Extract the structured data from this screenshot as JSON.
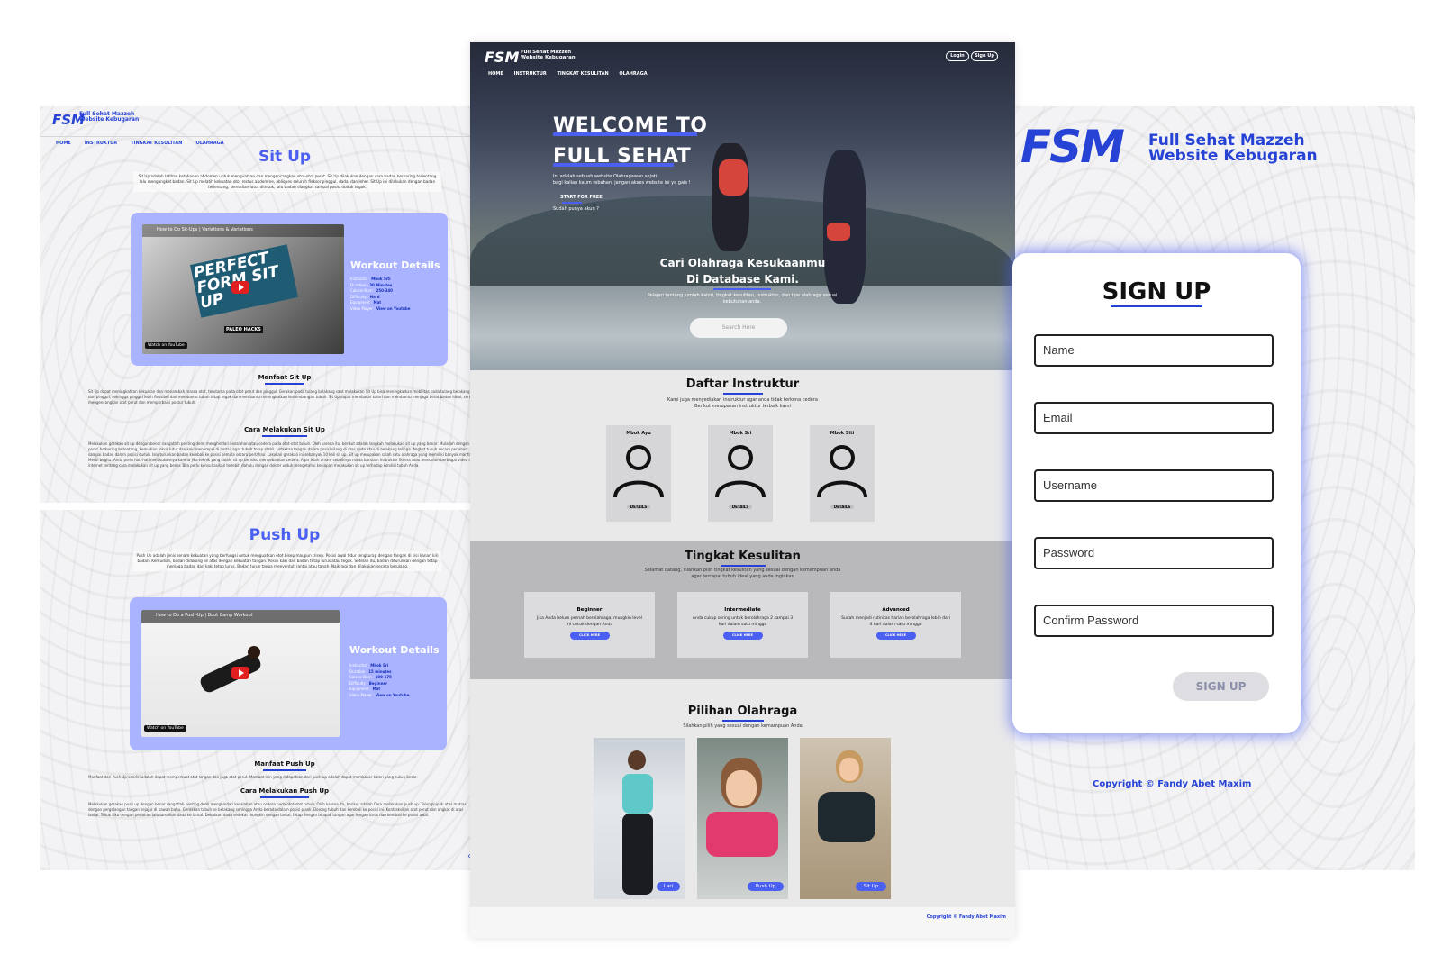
{
  "left_page": {
    "logo": "FSM",
    "brand_line1": "Full Sehat Mazzeh",
    "brand_line2": "Website Kebugaran",
    "nav": [
      "HOME",
      "INSTRUKTUR",
      "TINGKAT KESULITAN",
      "OLAHRAGA"
    ],
    "situp": {
      "title": "Sit Up",
      "intro": "Sit Up adalah latihan ketahanan abdomen untuk menguatkan dan mengencangkan otot-otot perut. Sit Up dilakukan dengan cara badan berbaring terlentang lalu mengangkat badan. Sit Up melatih kekuatan otot rectus abdomine, obliques seluruh fleksor pinggul, dada, dan leher. Sit Up ini dilakukan dengan badan terlentang, kemudian lutut ditekuk, lalu badan diangkat sampai posisi duduk tegak.",
      "video_title": "How to Do Sit-Ups | Variations & Variations",
      "video_caption": "PERFECT FORM SIT UP",
      "video_brand": "PALEO HACKS",
      "watch_on": "Watch on",
      "youtube": "YouTube",
      "details_title": "Workout Details",
      "details": [
        {
          "k": "Instructor",
          "v": "Mbok Siti"
        },
        {
          "k": "Duration",
          "v": "30 Minutes"
        },
        {
          "k": "Calorie Burn",
          "v": "250-340"
        },
        {
          "k": "Difficulty",
          "v": "Hard"
        },
        {
          "k": "Equipment",
          "v": "Mat"
        },
        {
          "k": "Video Player",
          "v": "View on Youtube"
        }
      ],
      "manfaat_title": "Manfaat Sit Up",
      "manfaat_text": "Sit Up dapat meningkatkan kekuatan dan menambah massa otot, terutama pada otot perut dan pinggul. Gerakan pada tulang belakang saat melakukan Sit Up bisa meningkatkan mobilitas pada tulang belakang dan pinggul, sehingga pinggul lebih fleksibel dan membantu tubuh tetap tegak dan membantu meningkatkan keseimbangan tubuh. Sit Up dapat membakar kalori dan membantu menjaga berat badan ideal, serta mengencangkan otot perut dan memperbaiki postur tubuh.",
      "cara_title": "Cara Melakukan Sit Up",
      "cara_text": "Melakukan gerakan sit up dengan benar sangatlah penting demi menghindari kesalahan atau cedera pada otot-otot tubuh. Oleh karena itu, berikut adalah langkah melakukan sit up yang benar: Mulailah dengan posisi berbaring terlentang, kemudian tekuk lutut dan kaki menempel di lantai, agar tubuh tetap stabil. Letakkan tangan dalam posisi silang di atas dada atau di belakang telinga. Angkat tubuh secara perlahan sampai badan dalam posisi duduk, lalu turunkan badan kembali ke posisi semula secara perlahan. Lakukan gerakan ini sebanyak 10 kali sit up. Sit up merupakan salah satu olahraga yang memiliki banyak manfaat. Meski begitu, Anda perlu hati-hati melakukannya karena jika teknik yang salah, sit up berisiko menyebabkan cedera. Agar lebih aman, sebaiknya minta bantuan instruktur fitness atau menonton berbagai video di internet tentang cara melakukan sit up yang benar. Bila perlu konsultasikan terlebih dahulu dengan dokter untuk mengetahui kesiapan melakukan sit up terhadap kondisi tubuh Anda.",
      "copyright_stub": "Co"
    },
    "pushup": {
      "title": "Push Up",
      "intro": "Push Up adalah jenis senam kekuatan yang berfungsi untuk menguatkan otot bisep maupun trisep. Posisi awal tidur tengkurap dengan tangan di sisi kanan kiri badan. Kemudian, badan didorong ke atas dengan kekuatan tangan. Posisi kaki dan badan tetap lurus atau tegak. Setelah itu, badan diturunkan dengan tetap menjaga badan dan kaki tetap lurus. Badan turun tanpa menyentuh lantai atau tanah. Naik lagi dan dilakukan secara berulang.",
      "video_title": "How to Do a Push-Up | Boot Camp Workout",
      "watch_on": "Watch on",
      "youtube": "YouTube",
      "details_title": "Workout Details",
      "details": [
        {
          "k": "Instructor",
          "v": "Mbok Sri"
        },
        {
          "k": "Duration",
          "v": "15 minutes"
        },
        {
          "k": "Calorie Burn",
          "v": "100-175"
        },
        {
          "k": "Difficulty",
          "v": "Beginner"
        },
        {
          "k": "Equipment",
          "v": "Mat"
        },
        {
          "k": "Video Player",
          "v": "View on Youtube"
        }
      ],
      "manfaat_title": "Manfaat Push Up",
      "manfaat_text": "Manfaat dari Push Up sendiri adalah dapat memperkuat otot lengan dan juga otot perut. Manfaat lain yang didapatkan dari push up adalah dapat membakar kalori yang cukup besar.",
      "cara_title": "Cara Melakukan Push Up",
      "cara_text": "Melakukan gerakan push up dengan benar sangatlah penting demi menghindari kesalahan atau cedera pada otot-otot tubuh. Oleh karena itu, berikut adalah Cara melakukan push up: Telungkup di atas matras dengan pergelangan tangan sejajar di bawah bahu. Gerakkan tubuh ke belakang sehingga Anda berada dalam posisi plank. Dorong tubuh dan kembali ke posisi ini. Kontraksikan otot perut dan angkat di atas lantai. Tekuk siku dengan perlahan lalu turunkan dada ke lantai. Dekatkan dada sedekat mungkin dengan lantai, tetap dengan telapak tangan agar lengan lurus dan kembali ke posisi awal.",
      "copyright_stub": "Co"
    }
  },
  "center_page": {
    "logo": "FSM",
    "brand_line1": "Full Sehat Mazzeh",
    "brand_line2": "Website Kebugaran",
    "login": "Login",
    "signup": "Sign Up",
    "nav": [
      "HOME",
      "INSTRUKTUR",
      "TINGKAT KESULITAN",
      "OLAHRAGA"
    ],
    "hero_line1": "WELCOME TO",
    "hero_line2": "FULL SEHAT",
    "hero_desc1": "Ini adalah sebuah website Olahragawan sejati",
    "hero_desc2": "bagi kalian kaum rebahan, jangan akses website ini ya gais !",
    "start_btn": "START FOR FREE",
    "already": "Sudah punya akun ?",
    "search_h1": "Cari Olahraga Kesukaanmu",
    "search_h2": "Di Database Kami.",
    "search_desc": "Pelajari tentang jumlah kalori, tingkat kesulitan, instruktur, dan tipe olahraga sesuai kebutuhan anda.",
    "search_placeholder": "Search Here",
    "instr_title": "Daftar Instruktur",
    "instr_sub1": "Kami juga menyediakan instruktur agar anda tidak terkena cedera",
    "instr_sub2": "Berikut merupakan instruktur terbaik kami",
    "instructors": [
      {
        "name": "Mbok Ayu",
        "btn": "DETAILS"
      },
      {
        "name": "Mbok Sri",
        "btn": "DETAILS"
      },
      {
        "name": "Mbok Siti",
        "btn": "DETAILS"
      }
    ],
    "level_title": "Tingkat Kesulitan",
    "level_sub1": "Selamat datang, silahkan pilih tingkat kesulitan yang sesuai dengan kemampuan anda",
    "level_sub2": "agar tercapai tubuh ideal yang anda inginkan",
    "levels": [
      {
        "name": "Beginner",
        "desc": "Jika Anda belum pernah berolahraga, mungkin level ini cocok dengan Anda",
        "btn": "CLICK HERE"
      },
      {
        "name": "Intermediate",
        "desc": "Anda cukup sering untuk berolahraga 2 sampai 3 hari dalam satu minggu",
        "btn": "CLICK HERE"
      },
      {
        "name": "Advanced",
        "desc": "Sudah menjadi rutinitas harian berolahraga lebih dari 4 hari dalam satu minggu",
        "btn": "CLICK HERE"
      }
    ],
    "sport_title": "Pilihan Olahraga",
    "sport_sub": "Silahkan pilih yang sesuai dengan kemampuan Anda",
    "sports": [
      "Lari",
      "Push Up",
      "Sit Up"
    ],
    "copyright": "Copyright © Fandy Abet Maxim"
  },
  "right_page": {
    "logo": "FSM",
    "brand_line1": "Full Sehat Mazzeh",
    "brand_line2": "Website Kebugaran",
    "form_title": "SIGN UP",
    "fields": [
      "Name",
      "Email",
      "Username",
      "Password",
      "Confirm Password"
    ],
    "submit": "SIGN UP",
    "copyright": "Copyright © Fandy Abet Maxim"
  },
  "colors": {
    "brand": "#2743d6",
    "accent": "#4b5ff0",
    "card_purple": "#aab3ff",
    "page_bg": "#e9e9ea"
  },
  "icons": [
    "youtube-play-icon",
    "user-avatar-icon"
  ]
}
